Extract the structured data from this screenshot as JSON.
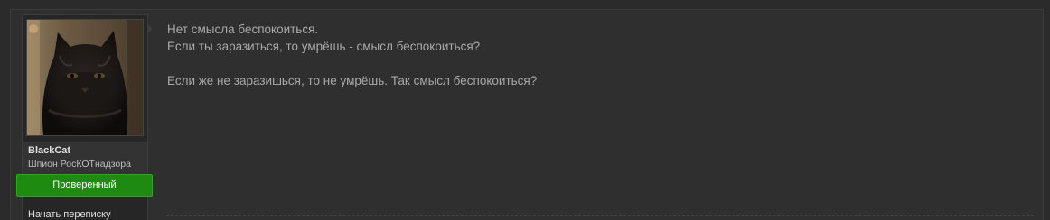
{
  "user": {
    "name": "BlackCat",
    "title": "Шпион РосКОТнадзора",
    "badge": "Проверенный",
    "start_conversation": "Начать переписку",
    "avatar": "black-cat-photo"
  },
  "message": {
    "line1": "Нет смысла беспокоиться.",
    "line2": "Если ты заразиться, то умрёшь - смысл беспокоиться?",
    "line3": "Если же не заразишься, то не умрёшь. Так смысл беспокоиться?"
  },
  "colors": {
    "background": "#2b2b2b",
    "badge": "#1f8a12",
    "text": "#a9a9a9"
  }
}
